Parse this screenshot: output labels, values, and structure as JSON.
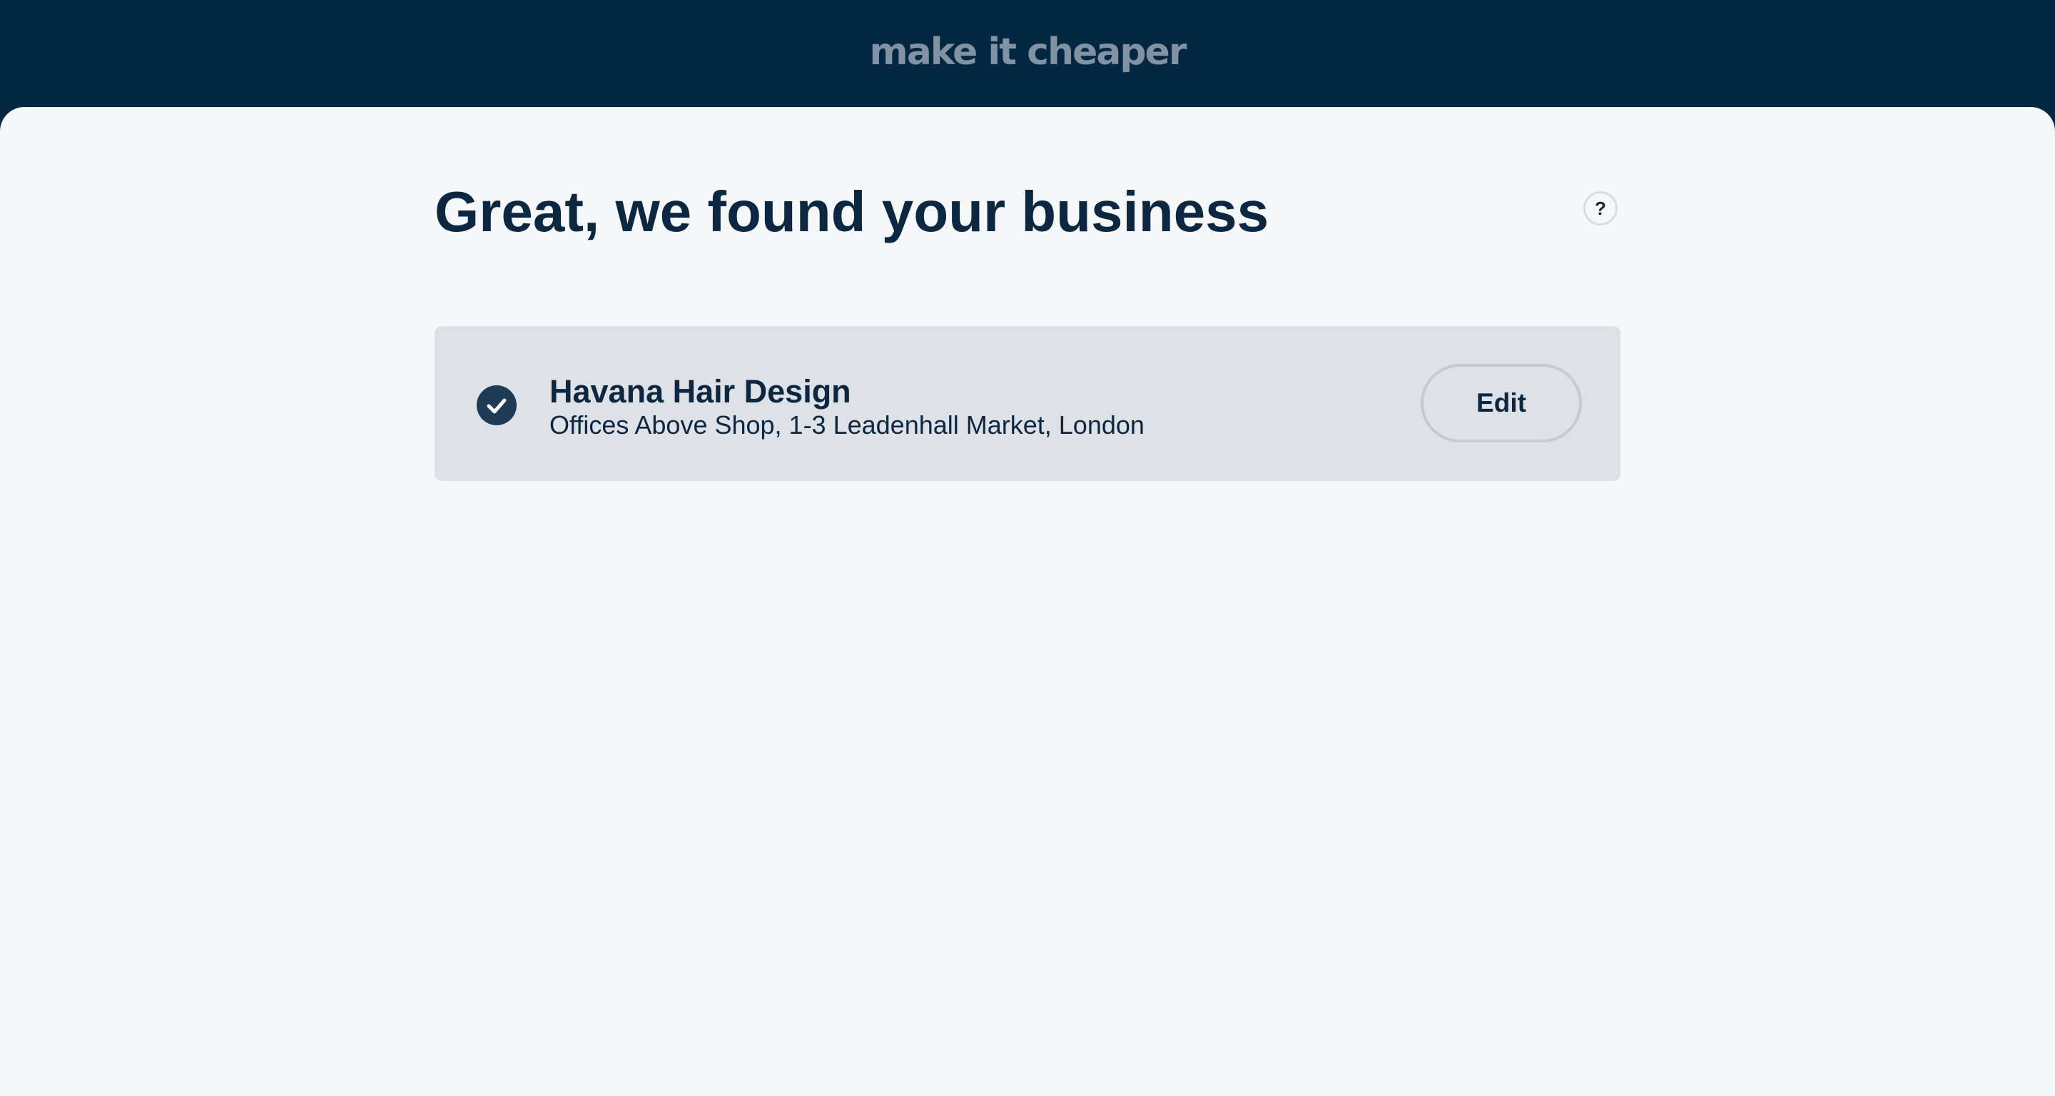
{
  "header": {
    "logo_text": "make it cheaper"
  },
  "main": {
    "title": "Great, we found your business",
    "help_label": "?"
  },
  "business_card": {
    "icon": "check-circle-icon",
    "name": "Havana Hair Design",
    "address": "Offices Above Shop, 1-3 Leadenhall Market, London",
    "edit_label": "Edit"
  },
  "colors": {
    "header_bg": "#022742",
    "page_bg": "#f6f7f9",
    "card_bg": "#dee2e6",
    "text_primary": "#0b2742",
    "logo": "#8193a3",
    "check_icon_bg": "#1e3a54"
  }
}
